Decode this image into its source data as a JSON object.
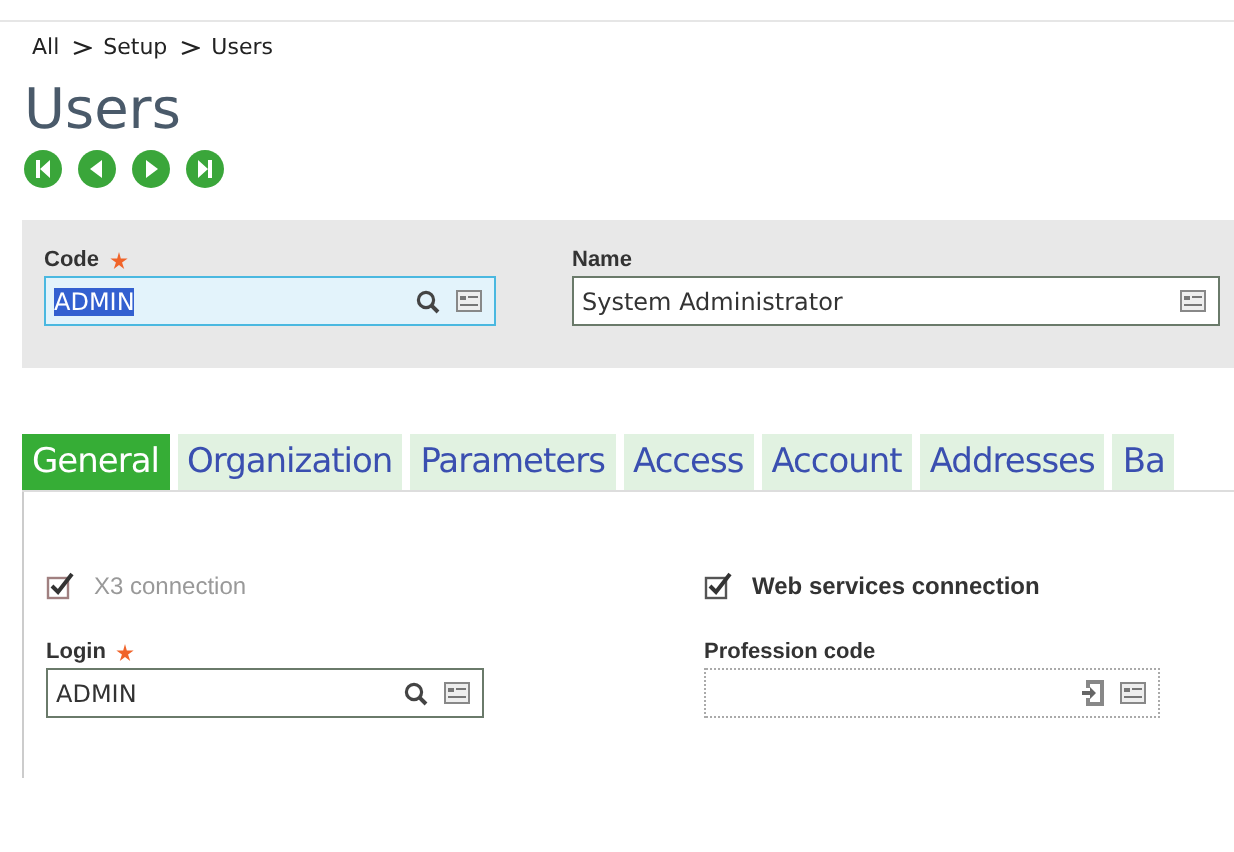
{
  "breadcrumb": [
    "All",
    "Setup",
    "Users"
  ],
  "title": "Users",
  "header_fields": [
    {
      "label": "Code",
      "required": true,
      "value": "ADMIN",
      "focused": true,
      "lookup": true
    },
    {
      "label": "Name",
      "required": false,
      "value": "System Administrator",
      "focused": false,
      "lookup": false
    }
  ],
  "tabs": [
    {
      "label": "General",
      "selected": true
    },
    {
      "label": "Organization",
      "selected": false
    },
    {
      "label": "Parameters",
      "selected": false
    },
    {
      "label": "Access",
      "selected": false
    },
    {
      "label": "Account",
      "selected": false
    },
    {
      "label": "Addresses",
      "selected": false
    },
    {
      "label": "Ba",
      "selected": false
    }
  ],
  "checkboxes": [
    {
      "label": "X3 connection",
      "checked": true,
      "disabled": true
    },
    {
      "label": "Web services connection",
      "checked": true,
      "disabled": false
    }
  ],
  "fields": [
    {
      "label": "Login",
      "required": true,
      "value": "ADMIN",
      "disabled": false
    },
    {
      "label": "Profession code",
      "required": false,
      "disabled": true
    }
  ]
}
